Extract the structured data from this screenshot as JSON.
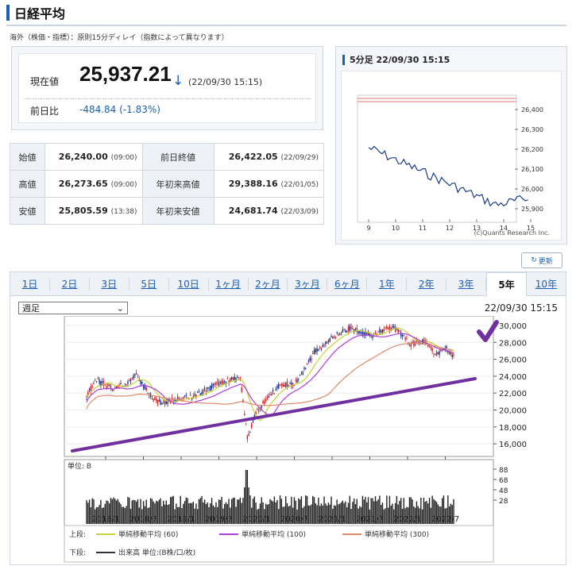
{
  "header": {
    "title": "日経平均",
    "notice": "海外（株価・指標）：原則15分ディレイ（指数によって異なります）"
  },
  "price": {
    "now_label": "現在値",
    "now_value": "25,937.21",
    "arrow": "↓",
    "timestamp": "(22/09/30 15:15)",
    "change_label": "前日比",
    "change_value": "-484.84 (-1.83%)"
  },
  "stats": [
    {
      "k1": "始値",
      "v1": "26,240.00",
      "t1": "(09:00)",
      "k2": "前日終値",
      "v2": "26,422.05",
      "t2": "(22/09/29)"
    },
    {
      "k1": "高値",
      "v1": "26,273.65",
      "t1": "(09:00)",
      "k2": "年初来高値",
      "v2": "29,388.16",
      "t2": "(22/01/05)"
    },
    {
      "k1": "安値",
      "v1": "25,805.59",
      "t1": "(13:38)",
      "k2": "年初来安値",
      "v2": "24,681.74",
      "t2": "(22/03/09)"
    }
  ],
  "mini_chart": {
    "title": "5分足 22/09/30 15:15",
    "y_ticks": [
      "26,400",
      "26,300",
      "26,200",
      "26,100",
      "26,000",
      "25,900"
    ],
    "x_ticks": [
      "9",
      "10",
      "11",
      "12",
      "13",
      "14",
      "15"
    ],
    "credit": "(c)Quants Research Inc."
  },
  "refresh_label": "更新",
  "tabs": [
    "1日",
    "2日",
    "3日",
    "5日",
    "10日",
    "1ヶ月",
    "2ヶ月",
    "3ヶ月",
    "6ヶ月",
    "1年",
    "2年",
    "3年",
    "5年",
    "10年"
  ],
  "active_tab": "5年",
  "select": {
    "value": "週足",
    "chevron": "chevron-down-icon"
  },
  "main_timestamp": "22/09/30 15:15",
  "main_chart": {
    "price_ticks": [
      "30,000",
      "28,000",
      "26,000",
      "24,000",
      "22,000",
      "20,000",
      "18,000",
      "16,000"
    ],
    "volume_label": "単位: B",
    "volume_ticks": [
      "88",
      "68",
      "48",
      "28"
    ],
    "x_ticks": [
      "2018/1",
      "2018/7",
      "2019/1",
      "2019/7",
      "2020/1",
      "2020/7",
      "2021/1",
      "2021/7",
      "2022/1",
      "2022/7"
    ],
    "legend_upper_label": "上段:",
    "legend_upper": [
      "単純移動平均 (60)",
      "単純移動平均 (100)",
      "単純移動平均 (300)"
    ],
    "legend_lower_label": "下段:",
    "legend_lower": [
      "出来高 単位:(B株/口/枚)"
    ],
    "colors": {
      "ma60": "#c6d23a",
      "ma100": "#b43cd6",
      "ma300": "#e08a6a",
      "up": "#d01c1c",
      "down": "#1a2f8a",
      "trend": "#7030a0"
    }
  }
}
